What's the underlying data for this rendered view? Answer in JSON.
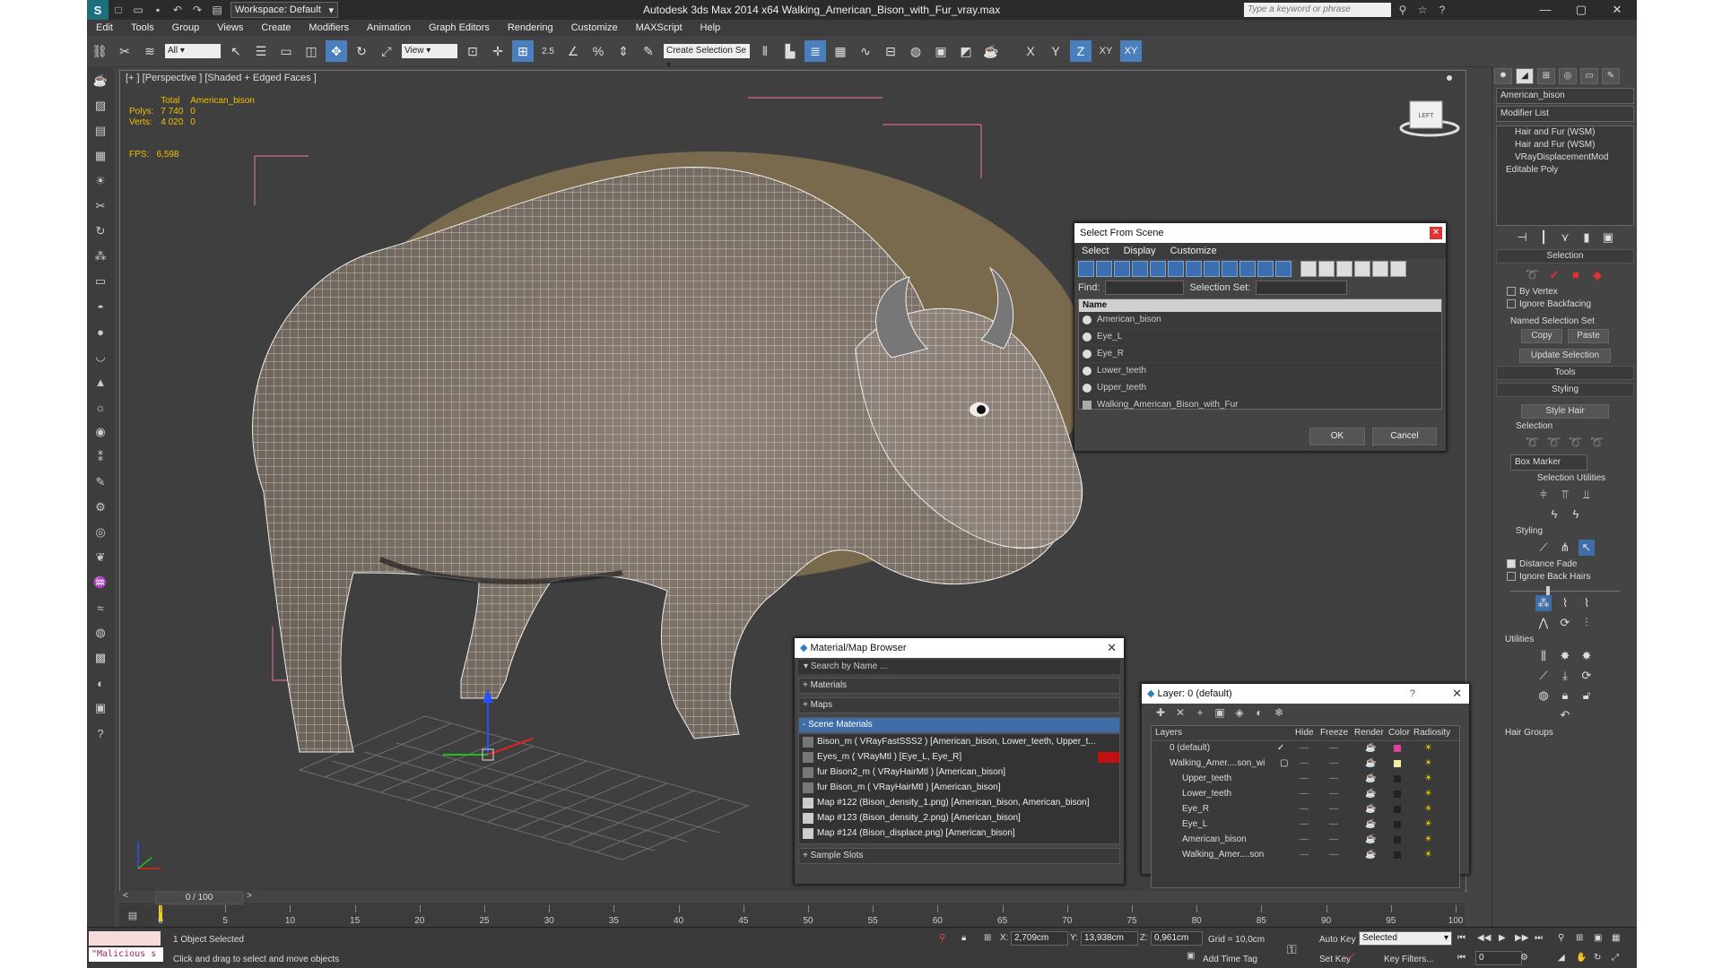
{
  "window": {
    "workspace": "Workspace: Default",
    "title": "Autodesk 3ds Max  2014 x64     Walking_American_Bison_with_Fur_vray.max",
    "search_placeholder": "Type a keyword or phrase"
  },
  "menu": [
    "Edit",
    "Tools",
    "Group",
    "Views",
    "Create",
    "Modifiers",
    "Animation",
    "Graph Editors",
    "Rendering",
    "Customize",
    "MAXScript",
    "Help"
  ],
  "toolbar": {
    "filter_value": "All",
    "view_value": "View",
    "angle_snap": "2.5",
    "named_sel_placeholder": "Create Selection Se",
    "axes": [
      "X",
      "Y",
      "Z",
      "XY",
      "XY"
    ]
  },
  "viewport": {
    "label": "[+ ] [Perspective ] [Shaded + Edged Faces ]",
    "stats": {
      "col_total": "Total",
      "col_object": "American_bison",
      "polys_label": "Polys:",
      "polys_total": "7 740",
      "polys_obj": "0",
      "verts_label": "Verts:",
      "verts_total": "4 020",
      "verts_obj": "0",
      "fps_label": "FPS:",
      "fps_value": "6,598"
    }
  },
  "select_from_scene": {
    "title": "Select From Scene",
    "menu": [
      "Select",
      "Display",
      "Customize"
    ],
    "find_label": "Find:",
    "selection_set_label": "Selection Set:",
    "column_name": "Name",
    "rows": [
      "American_bison",
      "Eye_L",
      "Eye_R",
      "Lower_teeth",
      "Upper_teeth",
      "Walking_American_Bison_with_Fur"
    ],
    "ok": "OK",
    "cancel": "Cancel"
  },
  "material_browser": {
    "title": "Material/Map Browser",
    "search": "Search by Name ...",
    "materials": "+ Materials",
    "maps": "+ Maps",
    "scene_materials": "- Scene Materials",
    "rows": [
      "Bison_m  ( VRayFastSSS2 ) [American_bison, Lower_teeth, Upper_t...",
      "Eyes_m  ( VRayMtl ) [Eye_L, Eye_R]",
      "fur Bison2_m  ( VRayHairMtl ) [American_bison]",
      "fur Bison_m  ( VRayHairMtl ) [American_bison]",
      "Map #122 (Bison_density_1.png) [American_bison, American_bison]",
      "Map #123 (Bison_density_2.png) [American_bison]",
      "Map #124 (Bison_displace.png) [American_bison]"
    ],
    "sample_slots": "+ Sample Slots"
  },
  "layer_manager": {
    "title": "Layer: 0 (default)",
    "help": "?",
    "columns": [
      "Layers",
      "Hide",
      "Freeze",
      "Render",
      "Color",
      "Radiosity"
    ],
    "rows": [
      {
        "name": "0 (default)",
        "color": "#e040a0"
      },
      {
        "name": "Walking_Amer....son_wi",
        "color": "#f0f0a0"
      },
      {
        "name": "Upper_teeth",
        "color": "#222222"
      },
      {
        "name": "Lower_teeth",
        "color": "#222222"
      },
      {
        "name": "Eye_R",
        "color": "#222222"
      },
      {
        "name": "Eye_L",
        "color": "#222222"
      },
      {
        "name": "American_bison",
        "color": "#222222"
      },
      {
        "name": "Walking_Amer....son",
        "color": "#222222"
      }
    ]
  },
  "command_panel": {
    "object_name": "American_bison",
    "modifier_list": "Modifier List",
    "stack": [
      "Hair and Fur (WSM)",
      "Hair and Fur (WSM)",
      "VRayDisplacementMod",
      "Editable Poly"
    ],
    "selection_head": "Selection",
    "by_vertex": "By Vertex",
    "ignore_backfacing": "Ignore Backfacing",
    "named_selection_set": "Named Selection Set",
    "copy": "Copy",
    "paste": "Paste",
    "update_selection": "Update Selection",
    "tools_head": "Tools",
    "styling_head": "Styling",
    "style_hair": "Style Hair",
    "selection_sub": "Selection",
    "box_marker": "Box Marker",
    "selection_utilities": "Selection Utilities",
    "styling_sub": "Styling",
    "distance_fade": "Distance Fade",
    "ignore_back_hairs": "Ignore Back Hairs",
    "utilities": "Utilities",
    "hair_groups": "Hair Groups"
  },
  "timeline": {
    "frame_counter": "0 / 100",
    "ticks": [
      "0",
      "5",
      "10",
      "15",
      "20",
      "25",
      "30",
      "35",
      "40",
      "45",
      "50",
      "55",
      "60",
      "65",
      "70",
      "75",
      "80",
      "85",
      "90",
      "95",
      "100"
    ]
  },
  "status": {
    "macro_text": "\"Malicious s",
    "selected": "1 Object Selected",
    "prompt": "Click and drag to select and move objects",
    "x_label": "X:",
    "x": "2,709cm",
    "y_label": "Y:",
    "y": "13,938cm",
    "z_label": "Z:",
    "z": "0,961cm",
    "grid": "Grid = 10,0cm",
    "add_time_tag": "Add Time Tag",
    "auto_key": "Auto Key",
    "set_key": "Set Key",
    "key_mode": "Selected",
    "key_filters": "Key Filters...",
    "current_frame": "0"
  }
}
